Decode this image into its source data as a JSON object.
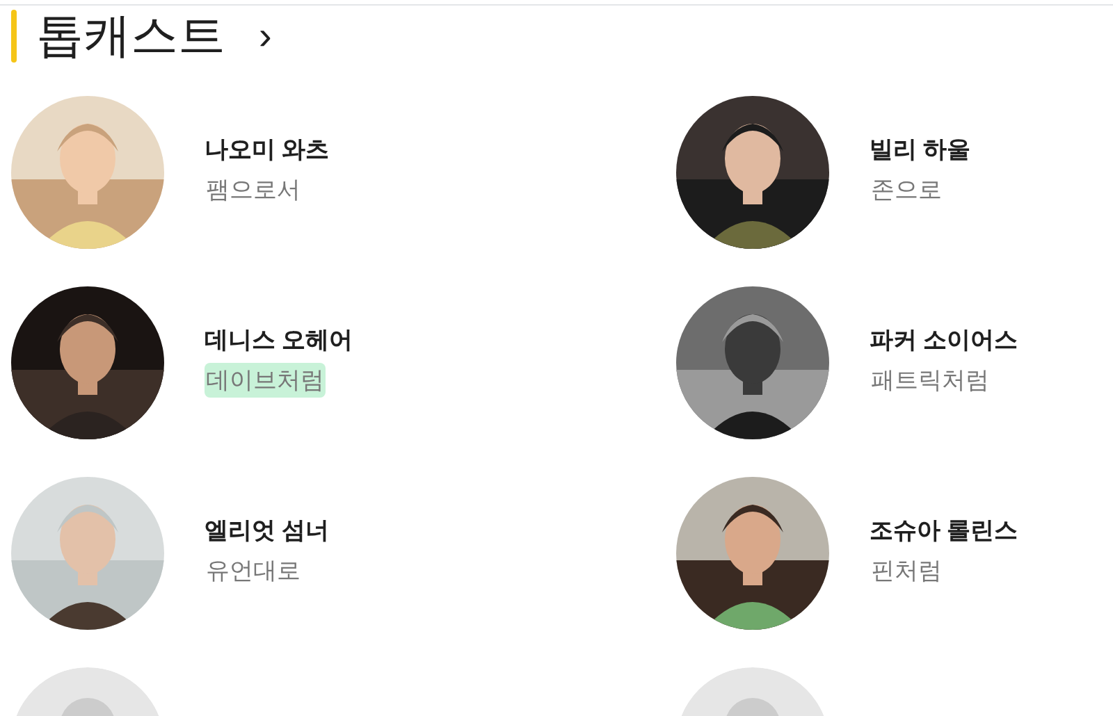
{
  "section": {
    "title": "톱캐스트",
    "more": "›"
  },
  "cast": [
    {
      "name": "나오미 와츠",
      "role": "팸으로서",
      "highlighted": false
    },
    {
      "name": "빌리 하울",
      "role": "존으로",
      "highlighted": false
    },
    {
      "name": "데니스 오헤어",
      "role": "데이브처럼",
      "highlighted": true
    },
    {
      "name": "파커 소이어스",
      "role": "패트릭처럼",
      "highlighted": false
    },
    {
      "name": "엘리엇 섬너",
      "role": "유언대로",
      "highlighted": false
    },
    {
      "name": "조슈아 롤린스",
      "role": "핀처럼",
      "highlighted": false
    },
    {
      "kind": "placeholder"
    },
    {
      "kind": "placeholder"
    }
  ]
}
